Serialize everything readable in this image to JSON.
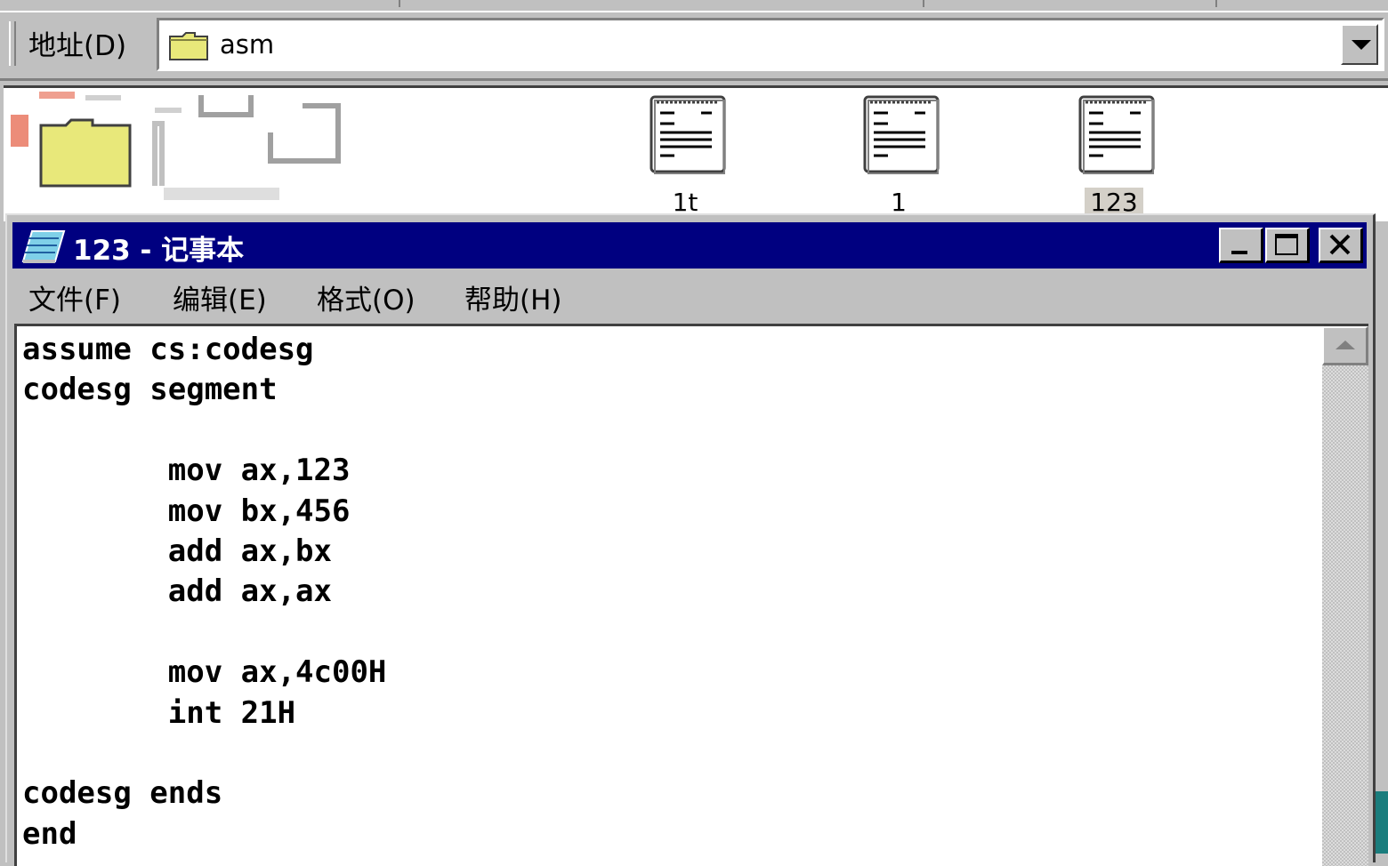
{
  "explorer": {
    "address": {
      "label": "地址(D)",
      "value": "asm",
      "folder_icon": "folder-icon",
      "dropdown_icon": "chevron-down-icon"
    },
    "files": [
      {
        "label": "1t",
        "icon": "text-document-icon",
        "selected": false
      },
      {
        "label": "1",
        "icon": "text-document-icon",
        "selected": false
      },
      {
        "label": "123",
        "icon": "text-document-icon",
        "selected": true
      }
    ]
  },
  "notepad": {
    "title": "123 - 记事本",
    "title_icon": "notepad-icon",
    "controls": [
      "minimize-icon",
      "maximize-icon",
      "close-icon"
    ],
    "menu": {
      "file": "文件(F)",
      "edit": "编辑(E)",
      "format": "格式(O)",
      "help": "帮助(H)"
    },
    "content": [
      "assume cs:codesg",
      "codesg segment",
      "",
      "        mov ax,123",
      "        mov bx,456",
      "        add ax,bx",
      "        add ax,ax",
      "",
      "        mov ax,4c00H",
      "        int 21H",
      "",
      "codesg ends",
      "end"
    ]
  },
  "colors": {
    "titlebar": "#000080",
    "window": "#c0c0c0",
    "folder": "#e8e87a"
  }
}
